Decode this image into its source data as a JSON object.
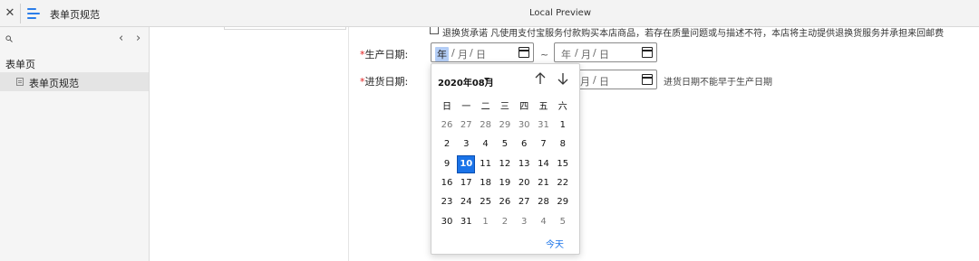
{
  "titlebar": {
    "close_glyph": "✕",
    "tab_label": "表单页规范",
    "window_title": "Local Preview"
  },
  "sidebar": {
    "group_label": "表单页",
    "items": [
      {
        "label": "表单页规范",
        "selected": true
      }
    ]
  },
  "form": {
    "cut_row_text": "退换货承诺      凡使用支付宝服务付款购买本店商品，若存在质量问题或与描述不符，本店将主动提供退换货服务并承担来回邮费",
    "required_mark": "*",
    "production_date": {
      "label": "生产日期:",
      "start": {
        "year": "年",
        "month": "月",
        "day": "日",
        "sep": "/"
      },
      "range_sep": "~",
      "end": {
        "year": "年",
        "month": "月",
        "day": "日",
        "sep": "/"
      }
    },
    "stock_date": {
      "label": "进货日期:",
      "month": "月",
      "day": "日",
      "sep": "/",
      "hint": "进货日期不能早于生产日期"
    }
  },
  "date_picker": {
    "month_label": "2020年08月",
    "weekdays": [
      "日",
      "一",
      "二",
      "三",
      "四",
      "五",
      "六"
    ],
    "weeks": [
      [
        {
          "d": "26",
          "o": true
        },
        {
          "d": "27",
          "o": true
        },
        {
          "d": "28",
          "o": true
        },
        {
          "d": "29",
          "o": true
        },
        {
          "d": "30",
          "o": true
        },
        {
          "d": "31",
          "o": true
        },
        {
          "d": "1"
        }
      ],
      [
        {
          "d": "2"
        },
        {
          "d": "3"
        },
        {
          "d": "4"
        },
        {
          "d": "5"
        },
        {
          "d": "6"
        },
        {
          "d": "7"
        },
        {
          "d": "8"
        }
      ],
      [
        {
          "d": "9"
        },
        {
          "d": "10",
          "s": true
        },
        {
          "d": "11"
        },
        {
          "d": "12"
        },
        {
          "d": "13"
        },
        {
          "d": "14"
        },
        {
          "d": "15"
        }
      ],
      [
        {
          "d": "16"
        },
        {
          "d": "17"
        },
        {
          "d": "18"
        },
        {
          "d": "19"
        },
        {
          "d": "20"
        },
        {
          "d": "21"
        },
        {
          "d": "22"
        }
      ],
      [
        {
          "d": "23"
        },
        {
          "d": "24"
        },
        {
          "d": "25"
        },
        {
          "d": "26"
        },
        {
          "d": "27"
        },
        {
          "d": "28"
        },
        {
          "d": "29"
        }
      ],
      [
        {
          "d": "30"
        },
        {
          "d": "31"
        },
        {
          "d": "1",
          "o": true
        },
        {
          "d": "2",
          "o": true
        },
        {
          "d": "3",
          "o": true
        },
        {
          "d": "4",
          "o": true
        },
        {
          "d": "5",
          "o": true
        }
      ]
    ],
    "today_label": "今天",
    "selected_color": "#1a73e8"
  },
  "colors": {
    "accent": "#1a73e8",
    "required": "#e02020",
    "menu_icon": "#2b7de9"
  },
  "icons": [
    "close-icon",
    "menu-icon",
    "search-icon",
    "chevron-left-icon",
    "chevron-right-icon",
    "document-icon",
    "calendar-icon",
    "arrow-up-icon",
    "arrow-down-icon",
    "caret-down-icon"
  ]
}
